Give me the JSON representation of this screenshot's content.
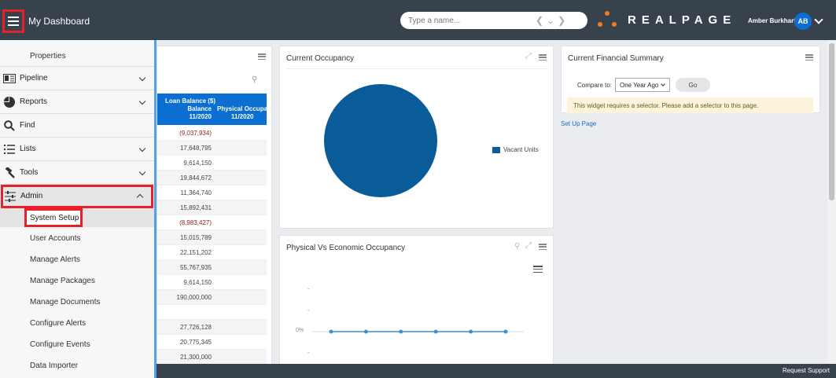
{
  "header": {
    "title": "My Dashboard",
    "search_placeholder": "Type a name...",
    "logo_text": "REALPAGE",
    "user_name": "Amber Burkhart",
    "user_initials": "AB",
    "brand_color": "#38424d",
    "accent_color": "#0a6fd1"
  },
  "sidebar": {
    "top_label": "Properties",
    "items": [
      {
        "label": "Pipeline",
        "icon": "pipeline-icon"
      },
      {
        "label": "Reports",
        "icon": "pie-chart-icon"
      },
      {
        "label": "Find",
        "icon": "search-icon"
      },
      {
        "label": "Lists",
        "icon": "list-icon"
      },
      {
        "label": "Tools",
        "icon": "hammer-icon"
      },
      {
        "label": "Admin",
        "icon": "sliders-icon"
      }
    ],
    "admin_sub": [
      "System Setup",
      "User Accounts",
      "Manage Alerts",
      "Manage Packages",
      "Manage Documents",
      "Configure Alerts",
      "Configure Events",
      "Data Importer"
    ]
  },
  "loan_table": {
    "headers": [
      "Loan Balance ($)",
      "Balance",
      "11/2020",
      "Physical Occupan",
      "11/2020"
    ],
    "values": [
      "(9,037,934)",
      "17,648,795",
      "9,614,150",
      "19,844,672",
      "11,364,740",
      "15,892,431",
      "(8,983,427)",
      "15,015,789",
      "22,151,202",
      "55,767,935",
      "9,614,150",
      "190,000,000",
      "",
      "27,726,128",
      "20,775,345",
      "21,300,000"
    ]
  },
  "occupancy": {
    "title": "Current Occupancy",
    "legend": "Vacant Units",
    "pie_color": "#0a5c99"
  },
  "financial": {
    "title": "Current Financial Summary",
    "compare_label": "Compare to:",
    "compare_value": "One Year Ago",
    "go_label": "Go",
    "warning": "This widget requires a selector. Please add a selector to this page.",
    "setup_link": "Set Up Page"
  },
  "phys_econ": {
    "title": "Physical Vs Economic Occupancy",
    "y_labels": [
      "-",
      "-",
      "0%",
      "-"
    ],
    "points": 6
  },
  "footer": {
    "support": "Request Support"
  }
}
